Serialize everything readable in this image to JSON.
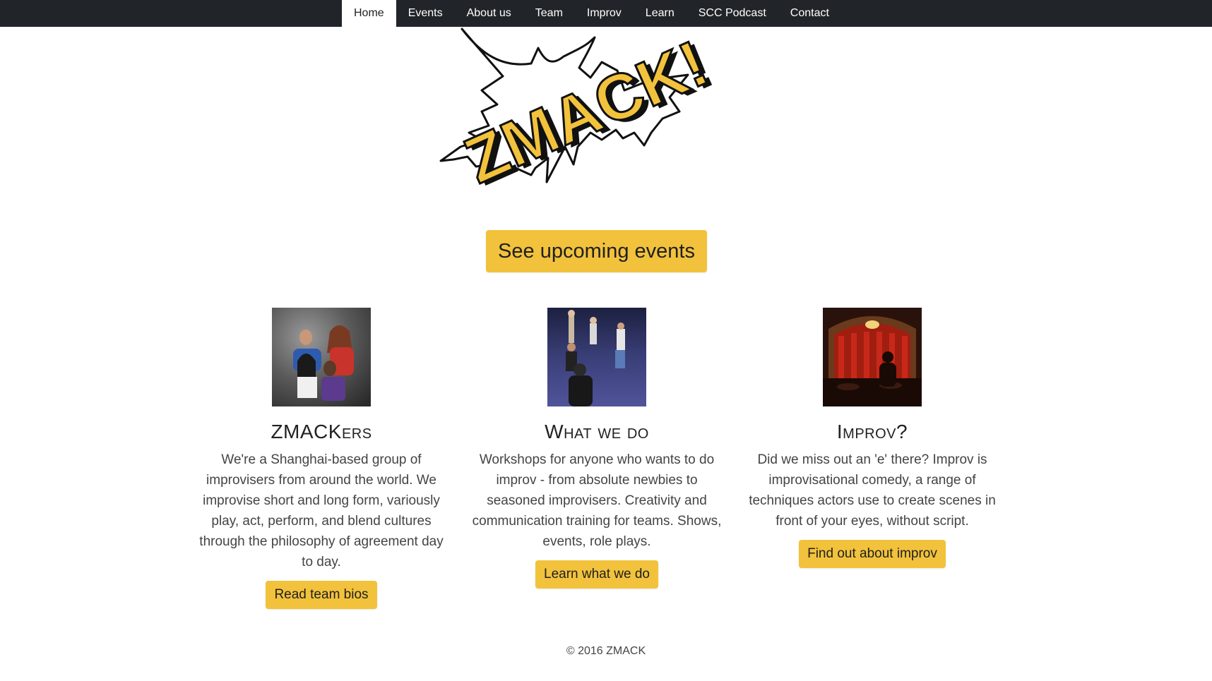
{
  "nav": {
    "items": [
      {
        "label": "Home",
        "active": true
      },
      {
        "label": "Events"
      },
      {
        "label": "About us"
      },
      {
        "label": "Team"
      },
      {
        "label": "Improv"
      },
      {
        "label": "Learn"
      },
      {
        "label": "SCC Podcast"
      },
      {
        "label": "Contact"
      }
    ]
  },
  "logo": {
    "text": "ZMACK!",
    "icon": "comic-burst-logo"
  },
  "hero": {
    "button_label": "See upcoming events"
  },
  "columns": [
    {
      "title": "ZMACKers",
      "text": "We're a Shanghai-based group of improvisers from around the world. We improvise short and long form, variously play, act, perform, and blend cultures through the philosophy of agreement day to day.",
      "button_label": "Read team bios"
    },
    {
      "title": "What we do",
      "text": "Workshops for anyone who wants to do improv - from absolute newbies to seasoned improvisers. Creativity and communication training for teams. Shows, events, role plays.",
      "button_label": "Learn what we do"
    },
    {
      "title": "Improv?",
      "text": "Did we miss out an 'e' there? Improv is improvisational comedy, a range of techniques actors use to create scenes in front of your eyes, without script.",
      "button_label": "Find out about improv"
    }
  ],
  "footer": {
    "text": "© 2016 ZMACK"
  },
  "colors": {
    "navbar": "#212529",
    "accent": "#f2c23c",
    "text": "#444444"
  }
}
